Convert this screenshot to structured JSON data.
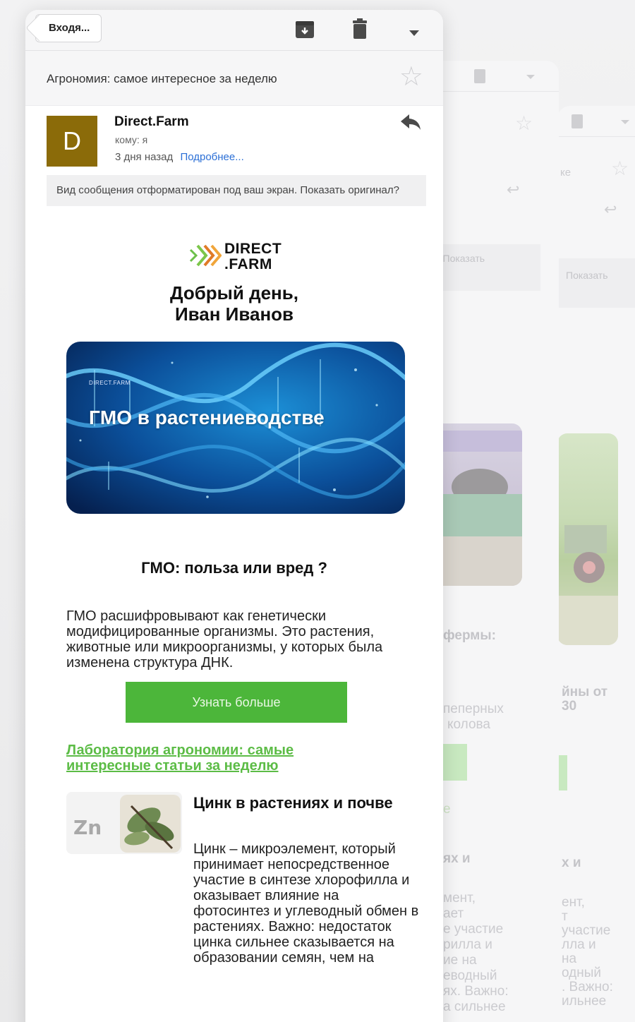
{
  "toolbar": {
    "back_label": "Входя...",
    "archive_icon": "archive-icon",
    "trash_icon": "trash-icon",
    "more_icon": "chevron-down-icon"
  },
  "subject": "Агрономия: самое интересное за неделю",
  "sender": {
    "avatar_letter": "D",
    "avatar_color": "#8b6b09",
    "name": "Direct.Farm",
    "to": "кому: я",
    "time": "3 дня назад",
    "details_link": "Подробнее..."
  },
  "notice": "Вид сообщения отформатирован под ваш экран. Показать оригинал?",
  "email": {
    "logo_line1": "DIRECT",
    "logo_line2": ".FARM",
    "greeting_line1": "Добрый день,",
    "greeting_line2": "Иван Иванов",
    "banner_brand": "DIRECT.FARM",
    "banner_title": "ГМО в растениеводстве",
    "article_title": "ГМО: польза или вред ?",
    "article_text": "ГМО расшифровывают как генетически модифицированные организмы. Это растения, животные или микроорганизмы, у которых была изменена структура ДНК.",
    "cta_label": "Узнать больше",
    "lab_link": "Лаборатория агрономии: самые интересные статьи за неделю",
    "zinc_thumb_text": "Zn",
    "zinc_title": "Цинк в растениях и почве",
    "zinc_text": "Цинк – микроэлемент, который принимает непосредственное участие в синтезе хлорофилла и оказывает влияние на фотосинтез и углеводный обмен в растениях. Важно: недостаток цинка сильнее сказывается на образовании семян, чем на"
  },
  "ghost1": {
    "notice_fragment": "н. Показать",
    "bold_fragment": "фермы:",
    "text_fragment_1": "пеперных",
    "text_fragment_2": "колова",
    "link_fragment": "е",
    "title_fragment": "ях и",
    "body_lines": [
      "мент,",
      "ает",
      "е участие",
      "рилла и",
      "ие на",
      "еводный",
      "ях. Важно:",
      "а сильнее"
    ]
  },
  "ghost2": {
    "subject_fragment": "ке",
    "notice_fragment": "Показать",
    "bold_fragment": "йны от",
    "bold_fragment_2": "30",
    "title_fragment": "х и",
    "body_lines": [
      "ент,",
      "т",
      "участие",
      "лла и",
      "на",
      "одный",
      ". Важно:",
      "ильнее"
    ]
  },
  "colors": {
    "accent_green": "#4cb63a",
    "link_blue": "#2b6fd6",
    "link_green": "#5cbc46"
  }
}
